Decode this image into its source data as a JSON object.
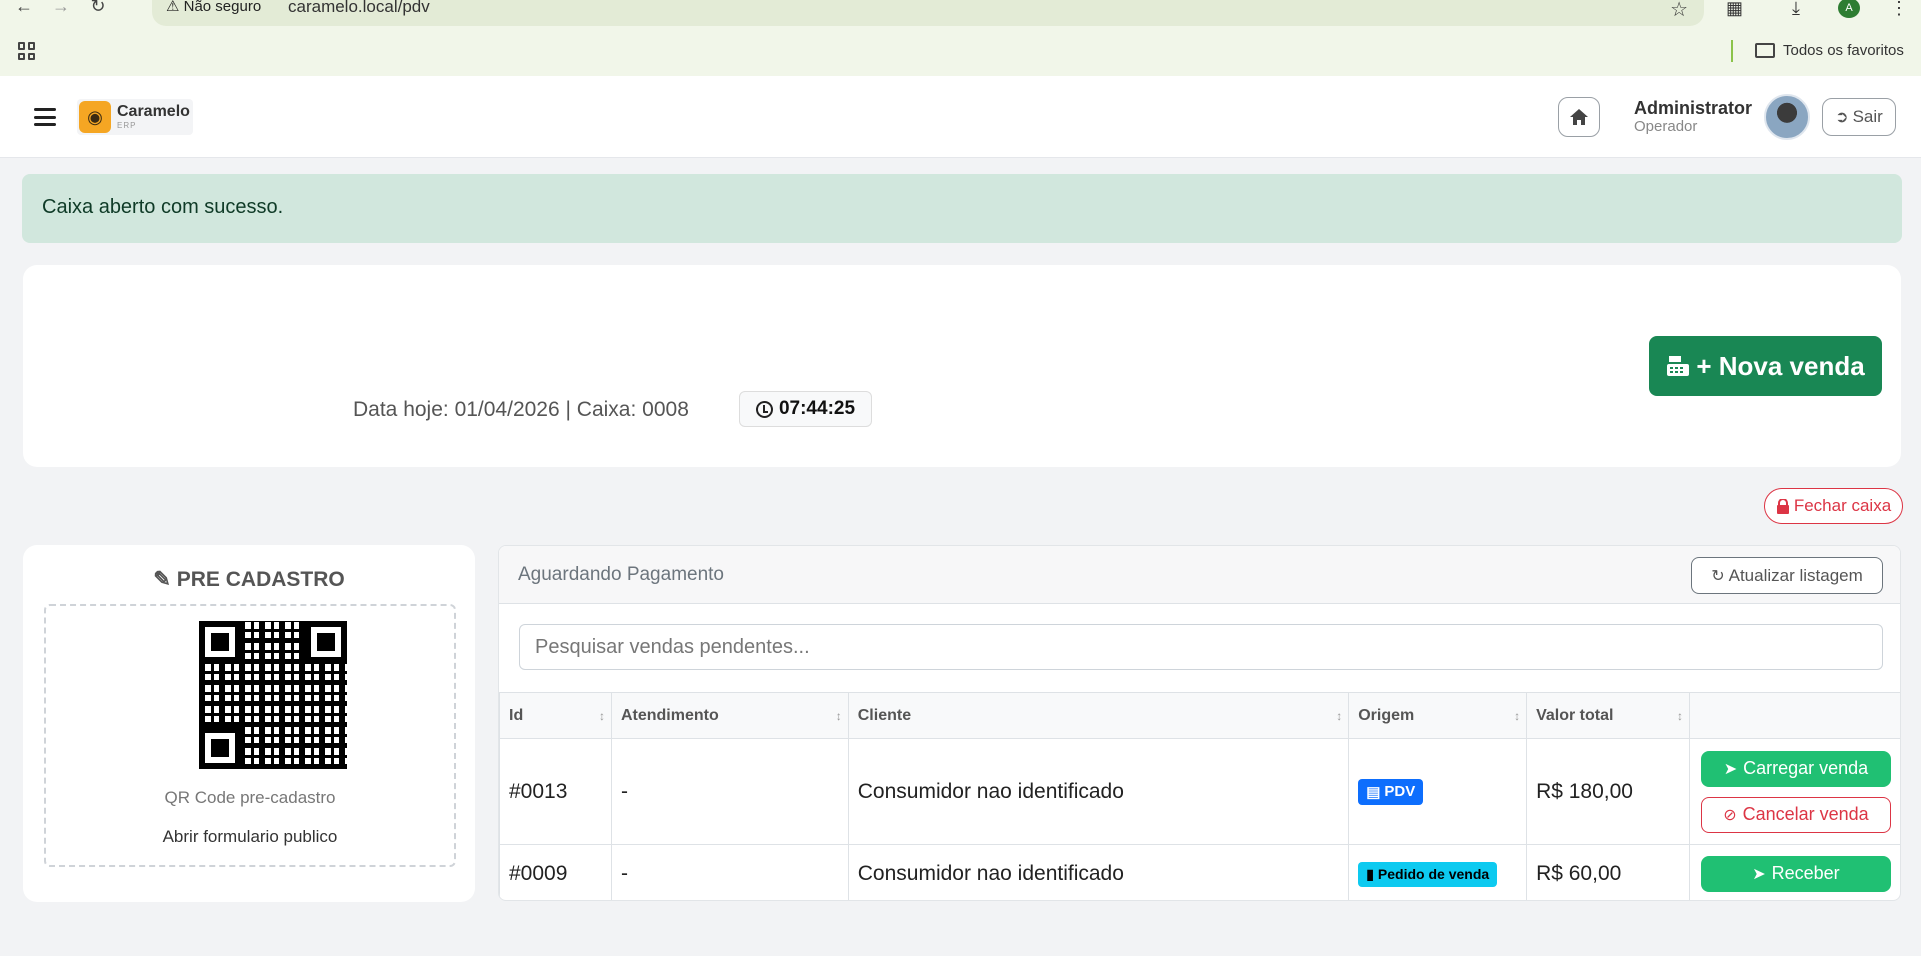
{
  "browser": {
    "security_label": "Não seguro",
    "url": "caramelo.local/pdv",
    "bookmarks_folder": "Todos os favoritos",
    "profile_initial": "A"
  },
  "header": {
    "brand_name": "Caramelo",
    "brand_sub": "ERP",
    "user_name": "Administrator",
    "user_role": "Operador",
    "logout_label": "Sair"
  },
  "alert": {
    "message": "Caixa aberto com sucesso."
  },
  "info": {
    "date_line": "Data hoje: 01/04/2026 | Caixa: 0008",
    "clock": "07:44:25",
    "new_sale_label": "+ Nova venda"
  },
  "close_box_label": "Fechar caixa",
  "pre_cadastro": {
    "title": "PRE CADASTRO",
    "qr_caption": "QR Code pre-cadastro",
    "public_form_link": "Abrir formulario publico"
  },
  "pending": {
    "title": "Aguardando Pagamento",
    "refresh_label": "Atualizar listagem",
    "search_placeholder": "Pesquisar vendas pendentes...",
    "columns": [
      "Id",
      "Atendimento",
      "Cliente",
      "Origem",
      "Valor total"
    ],
    "rows": [
      {
        "id": "#0013",
        "atendimento": "-",
        "cliente": "Consumidor nao identificado",
        "origem": "PDV",
        "valor": "R$ 180,00",
        "action1": "Carregar venda",
        "action2": "Cancelar venda"
      },
      {
        "id": "#0009",
        "atendimento": "-",
        "cliente": "Consumidor nao identificado",
        "origem": "Pedido de venda",
        "valor": "R$ 60,00",
        "action1": "Receber"
      }
    ]
  },
  "colors": {
    "success": "#198754",
    "alert_bg": "#d1e7dd",
    "danger": "#dc3545",
    "accent_green": "#20c073",
    "info": "#0dcaf0",
    "primary": "#0d6efd"
  }
}
